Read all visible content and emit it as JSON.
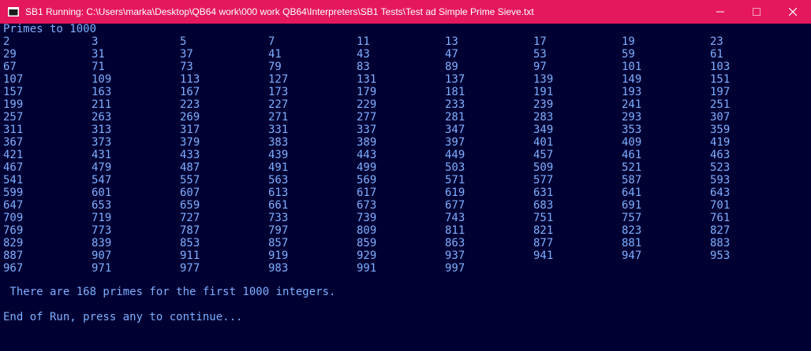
{
  "window": {
    "title": "SB1 Running: C:\\Users\\marka\\Desktop\\QB64 work\\000 work QB64\\Interpreters\\SB1 Tests\\Test ad Simple Prime Sieve.txt",
    "icon": "console-app-icon",
    "accent_color": "#e5185e"
  },
  "console": {
    "background_color": "#000033",
    "text_color": "#7fb0ff",
    "header": "Primes to 1000",
    "rows": [
      [
        "2",
        "3",
        "5",
        "7",
        "11",
        "13",
        "17",
        "19",
        "23"
      ],
      [
        "29",
        "31",
        "37",
        "41",
        "43",
        "47",
        "53",
        "59",
        "61"
      ],
      [
        "67",
        "71",
        "73",
        "79",
        "83",
        "89",
        "97",
        "101",
        "103"
      ],
      [
        "107",
        "109",
        "113",
        "127",
        "131",
        "137",
        "139",
        "149",
        "151"
      ],
      [
        "157",
        "163",
        "167",
        "173",
        "179",
        "181",
        "191",
        "193",
        "197"
      ],
      [
        "199",
        "211",
        "223",
        "227",
        "229",
        "233",
        "239",
        "241",
        "251"
      ],
      [
        "257",
        "263",
        "269",
        "271",
        "277",
        "281",
        "283",
        "293",
        "307"
      ],
      [
        "311",
        "313",
        "317",
        "331",
        "337",
        "347",
        "349",
        "353",
        "359"
      ],
      [
        "367",
        "373",
        "379",
        "383",
        "389",
        "397",
        "401",
        "409",
        "419"
      ],
      [
        "421",
        "431",
        "433",
        "439",
        "443",
        "449",
        "457",
        "461",
        "463"
      ],
      [
        "467",
        "479",
        "487",
        "491",
        "499",
        "503",
        "509",
        "521",
        "523"
      ],
      [
        "541",
        "547",
        "557",
        "563",
        "569",
        "571",
        "577",
        "587",
        "593"
      ],
      [
        "599",
        "601",
        "607",
        "613",
        "617",
        "619",
        "631",
        "641",
        "643"
      ],
      [
        "647",
        "653",
        "659",
        "661",
        "673",
        "677",
        "683",
        "691",
        "701"
      ],
      [
        "709",
        "719",
        "727",
        "733",
        "739",
        "743",
        "751",
        "757",
        "761"
      ],
      [
        "769",
        "773",
        "787",
        "797",
        "809",
        "811",
        "821",
        "823",
        "827"
      ],
      [
        "829",
        "839",
        "853",
        "857",
        "859",
        "863",
        "877",
        "881",
        "883"
      ],
      [
        "887",
        "907",
        "911",
        "919",
        "929",
        "937",
        "941",
        "947",
        "953"
      ],
      [
        "967",
        "971",
        "977",
        "983",
        "991",
        "997"
      ]
    ],
    "summary": " There are 168 primes for the first 1000 integers.",
    "footer": "End of Run, press any to continue..."
  }
}
